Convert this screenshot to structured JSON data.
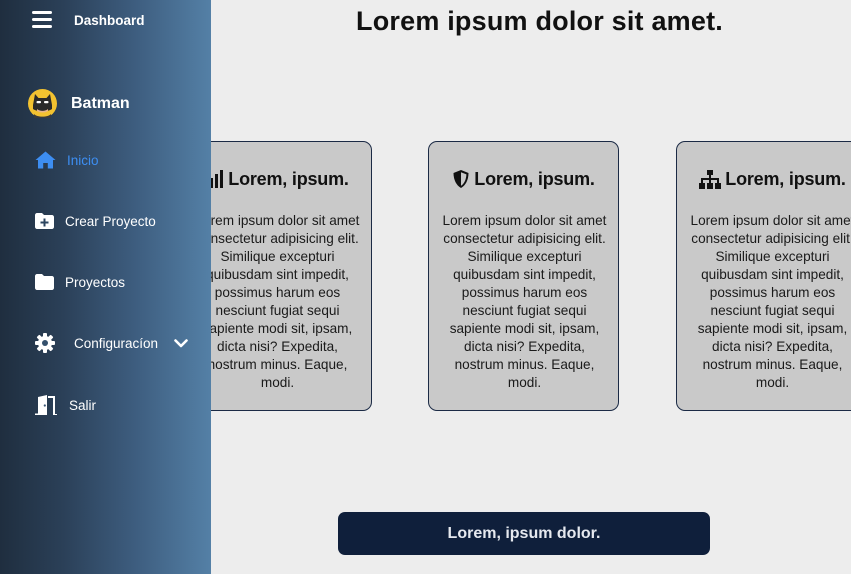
{
  "sidebar": {
    "brand": "Dashboard",
    "user": {
      "name": "Batman"
    },
    "items": [
      {
        "label": "Inicio",
        "icon": "home-icon",
        "active": true
      },
      {
        "label": "Crear Proyecto",
        "icon": "folder-plus-icon"
      },
      {
        "label": "Proyectos",
        "icon": "folder-icon"
      },
      {
        "label": "Configuracíon",
        "icon": "gear-icon",
        "expandable": true
      },
      {
        "label": "Salir",
        "icon": "door-exit-icon"
      }
    ]
  },
  "main": {
    "title": "Lorem ipsum dolor sit amet.",
    "cards": [
      {
        "icon": "signal-bars-icon",
        "title": "Lorem, ipsum.",
        "lines": [
          "Lorem ipsum dolor sit amet",
          "consectetur adipisicing elit.",
          "Similique excepturi",
          "quibusdam sint impedit,",
          "possimus harum eos",
          "nesciunt fugiat sequi",
          "sapiente modi sit, ipsam,",
          "dicta nisi? Expedita,",
          "nostrum minus. Eaque,",
          "modi."
        ]
      },
      {
        "icon": "shield-icon",
        "title": "Lorem, ipsum.",
        "lines": [
          "Lorem ipsum dolor sit amet",
          "consectetur adipisicing elit.",
          "Similique excepturi",
          "quibusdam sint impedit,",
          "possimus harum eos",
          "nesciunt fugiat sequi",
          "sapiente modi sit, ipsam,",
          "dicta nisi? Expedita,",
          "nostrum minus. Eaque,",
          "modi."
        ]
      },
      {
        "icon": "sitemap-icon",
        "title": "Lorem, ipsum.",
        "lines": [
          "Lorem ipsum dolor sit amet",
          "consectetur adipisicing elit.",
          "Similique excepturi",
          "quibusdam sint impedit,",
          "possimus harum eos",
          "nesciunt fugiat sequi",
          "sapiente modi sit, ipsam,",
          "dicta nisi? Expedita,",
          "nostrum minus. Eaque,",
          "modi."
        ]
      }
    ],
    "cta_label": "Lorem, ipsum dolor."
  },
  "colors": {
    "sidebar_gradient_start": "#1f2e3f",
    "sidebar_gradient_end": "#5480a6",
    "active_nav": "#3d8ef2",
    "card_bg": "#c9c9c9",
    "card_border": "#1b2a45",
    "button_bg": "#0f1f3b",
    "page_bg": "#ededed"
  }
}
